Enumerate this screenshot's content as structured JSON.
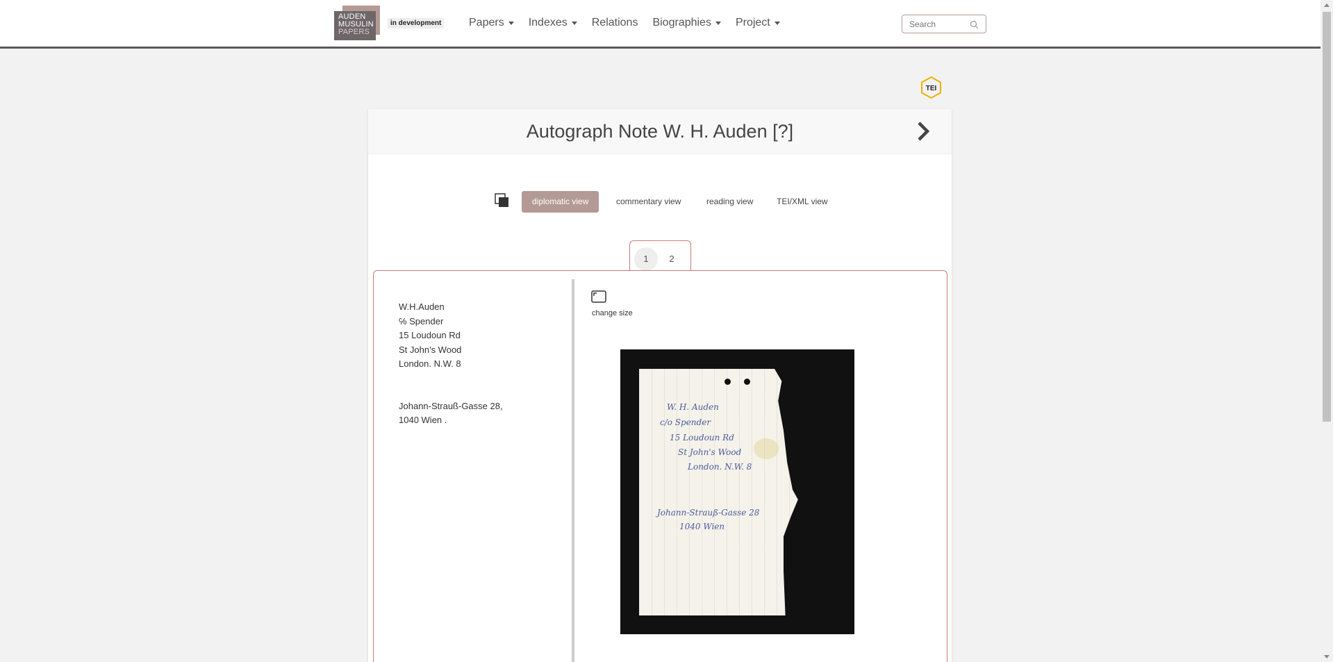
{
  "header": {
    "logo_lines": [
      "AUDEN",
      "MUSULIN",
      "PAPERS"
    ],
    "badge": "in development",
    "nav": [
      {
        "label": "Papers",
        "dropdown": true
      },
      {
        "label": "Indexes",
        "dropdown": true
      },
      {
        "label": "Relations",
        "dropdown": false
      },
      {
        "label": "Biographies",
        "dropdown": true
      },
      {
        "label": "Project",
        "dropdown": true
      }
    ],
    "search_placeholder": "Search"
  },
  "document": {
    "title": "Autograph Note W. H. Auden [?]",
    "tei_label": "TEI",
    "views": [
      {
        "label": "diplomatic view",
        "active": true
      },
      {
        "label": "commentary view",
        "active": false
      },
      {
        "label": "reading view",
        "active": false
      },
      {
        "label": "TEI/XML view",
        "active": false
      }
    ],
    "pages": [
      {
        "label": "1",
        "active": true
      },
      {
        "label": "2",
        "active": false
      }
    ],
    "transcript": {
      "block1": [
        "W.H.Auden",
        "℅ Spender",
        "15 Loudoun Rd",
        "St John's Wood",
        "London. N.W. 8"
      ],
      "block2": [
        "Johann-Strauß-Gasse 28,",
        "1040 Wien ."
      ]
    },
    "change_size_label": "change size"
  },
  "colors": {
    "accent": "#b49a94",
    "border": "#c97b7b",
    "navbar_rule": "#5e5858"
  }
}
